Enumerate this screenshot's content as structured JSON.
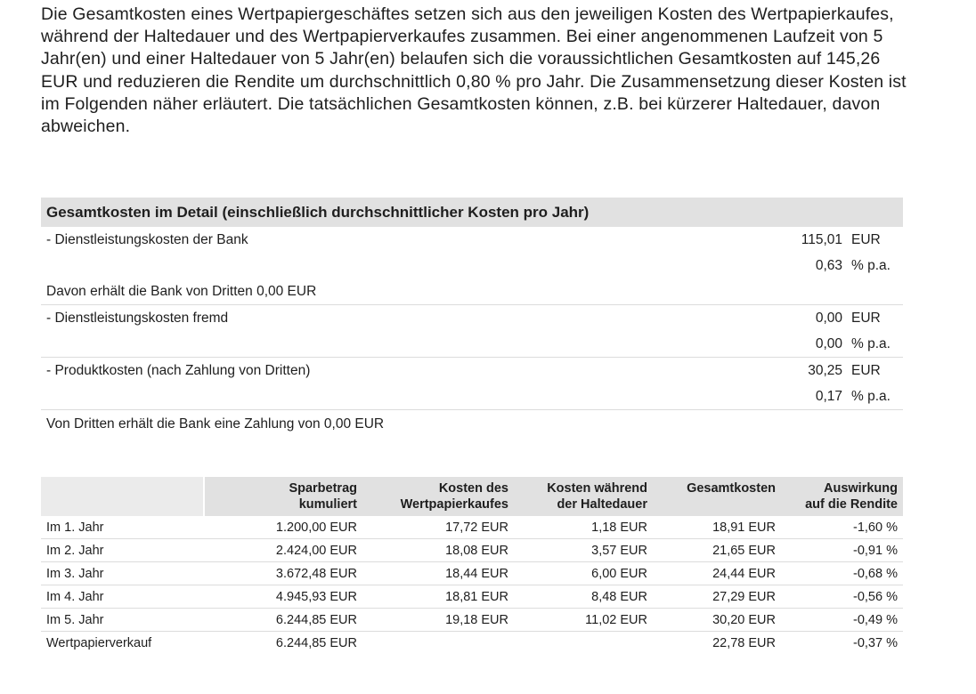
{
  "intro_text": "Die Gesamtkosten eines Wertpapiergeschäftes setzen sich aus den jeweiligen Kosten des Wertpapierkaufes, während der Haltedauer und des Wertpapierverkaufes zusammen. Bei einer angenommenen Laufzeit von 5 Jahr(en) und einer Haltedauer von 5 Jahr(en) belaufen sich die voraussichtlichen Gesamtkosten auf 145,26 EUR und reduzieren die Rendite um durchschnittlich 0,80 % pro Jahr. Die Zusammensetzung dieser Kosten ist im Folgenden näher erläutert. Die tatsächlichen Gesamtkosten können, z.B. bei kürzerer Haltedauer, davon abweichen.",
  "detail": {
    "title": "Gesamtkosten im Detail (einschließlich durchschnittlicher Kosten pro Jahr)",
    "bank": {
      "label": "- Dienstleistungskosten der Bank",
      "amount": "115,01",
      "amount_unit": "EUR",
      "rate": "0,63",
      "rate_unit": "% p.a."
    },
    "bank_note": "Davon erhält die Bank von Dritten 0,00 EUR",
    "foreign": {
      "label": "- Dienstleistungskosten fremd",
      "amount": "0,00",
      "amount_unit": "EUR",
      "rate": "0,00",
      "rate_unit": "% p.a."
    },
    "product": {
      "label": "- Produktkosten (nach Zahlung von Dritten)",
      "amount": "30,25",
      "amount_unit": "EUR",
      "rate": "0,17",
      "rate_unit": "% p.a."
    },
    "third_party_note": "Von Dritten erhält die Bank eine Zahlung von 0,00 EUR"
  },
  "yearly": {
    "headers": {
      "col1_line1": "Sparbetrag",
      "col1_line2": "kumuliert",
      "col2_line1": "Kosten des",
      "col2_line2": "Wertpapierkaufes",
      "col3_line1": "Kosten während",
      "col3_line2": "der Haltedauer",
      "col4_line1": "Gesamtkosten",
      "col4_line2": "",
      "col5_line1": "Auswirkung",
      "col5_line2": "auf die Rendite"
    },
    "rows": [
      {
        "label": "Im 1. Jahr",
        "sparbetrag": "1.200,00 EUR",
        "kauf": "17,72 EUR",
        "halte": "1,18 EUR",
        "gesamt": "18,91 EUR",
        "rendite": "-1,60 %"
      },
      {
        "label": "Im 2. Jahr",
        "sparbetrag": "2.424,00 EUR",
        "kauf": "18,08 EUR",
        "halte": "3,57 EUR",
        "gesamt": "21,65 EUR",
        "rendite": "-0,91 %"
      },
      {
        "label": "Im 3. Jahr",
        "sparbetrag": "3.672,48 EUR",
        "kauf": "18,44 EUR",
        "halte": "6,00 EUR",
        "gesamt": "24,44 EUR",
        "rendite": "-0,68 %"
      },
      {
        "label": "Im 4. Jahr",
        "sparbetrag": "4.945,93 EUR",
        "kauf": "18,81 EUR",
        "halte": "8,48 EUR",
        "gesamt": "27,29 EUR",
        "rendite": "-0,56 %"
      },
      {
        "label": "Im 5. Jahr",
        "sparbetrag": "6.244,85 EUR",
        "kauf": "19,18 EUR",
        "halte": "11,02 EUR",
        "gesamt": "30,20 EUR",
        "rendite": "-0,49 %"
      },
      {
        "label": "Wertpapierverkauf",
        "sparbetrag": "6.244,85 EUR",
        "kauf": "",
        "halte": "",
        "gesamt": "22,78 EUR",
        "rendite": "-0,37 %"
      }
    ]
  }
}
